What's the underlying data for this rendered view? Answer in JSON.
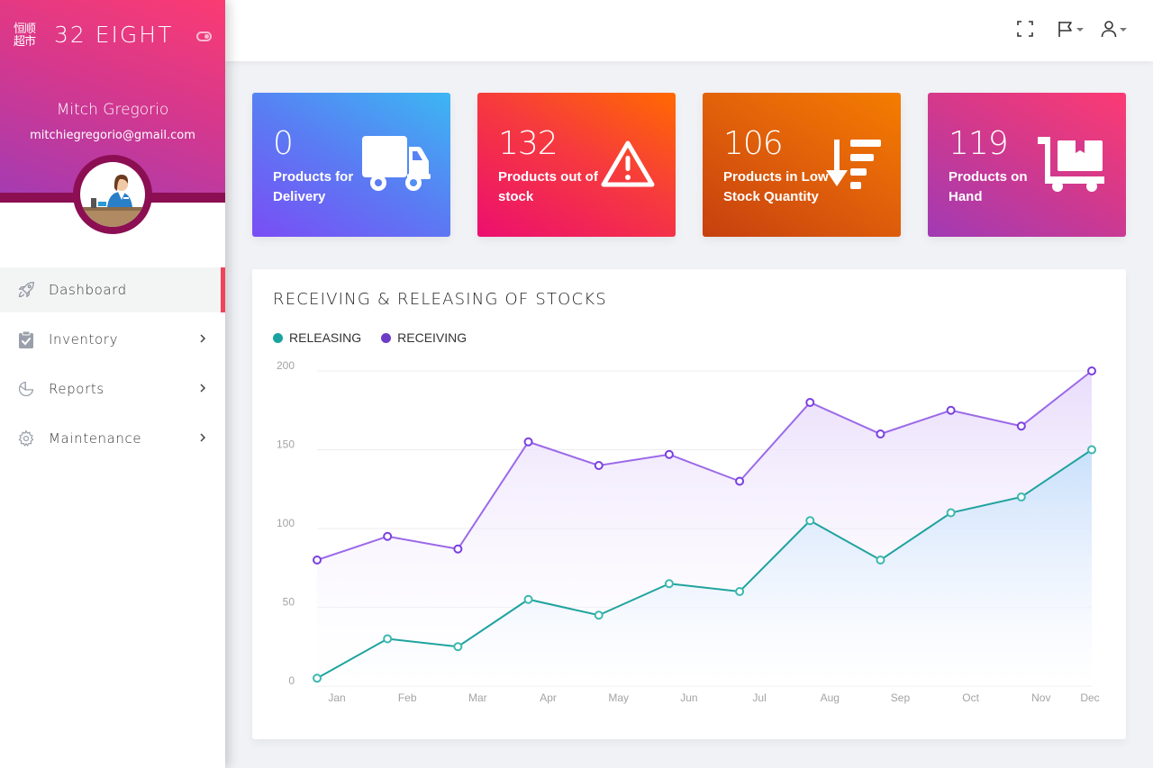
{
  "sidebar": {
    "logo_text": "恒顺超市",
    "brand": "32 EIGHT",
    "user": {
      "name": "Mitch Gregorio",
      "email": "mitchiegregorio@gmail.com"
    },
    "items": [
      {
        "label": "Dashboard",
        "icon": "rocket-icon",
        "active": true,
        "has_submenu": false
      },
      {
        "label": "Inventory",
        "icon": "clipboard-check-icon",
        "active": false,
        "has_submenu": true
      },
      {
        "label": "Reports",
        "icon": "pie-chart-icon",
        "active": false,
        "has_submenu": true
      },
      {
        "label": "Maintenance",
        "icon": "gear-icon",
        "active": false,
        "has_submenu": true
      }
    ],
    "accent_color": "#f0425b"
  },
  "topbar": {
    "icons": [
      "fullscreen-icon",
      "flag-icon",
      "user-icon"
    ]
  },
  "stats": [
    {
      "value": "0",
      "label": "Products for Delivery",
      "icon": "truck-icon",
      "gradient": [
        "#7b4cf5",
        "#3db6f3"
      ]
    },
    {
      "value": "132",
      "label": "Products out of stock",
      "icon": "warning-icon",
      "gradient": [
        "#ec1a6e",
        "#ff6a00"
      ]
    },
    {
      "value": "106",
      "label": "Products in Low Stock Quantity",
      "icon": "sort-amount-down-icon",
      "gradient": [
        "#c9420e",
        "#f27d00"
      ]
    },
    {
      "value": "119",
      "label": "Products on Hand",
      "icon": "dolly-box-icon",
      "gradient": [
        "#a33ab3",
        "#fc3a74"
      ]
    }
  ],
  "chart": {
    "title": "RECEIVING & RELEASING OF STOCKS"
  },
  "chart_data": {
    "type": "area",
    "title": "RECEIVING & RELEASING OF STOCKS",
    "xlabel": "",
    "ylabel": "",
    "categories": [
      "Jan",
      "Feb",
      "Mar",
      "Apr",
      "May",
      "Jun",
      "Jul",
      "Aug",
      "Sep",
      "Oct",
      "Nov",
      "Dec"
    ],
    "series": [
      {
        "name": "RELEASING",
        "color": "#1aa39e",
        "values": [
          5,
          30,
          25,
          55,
          45,
          65,
          60,
          105,
          80,
          110,
          120,
          150
        ]
      },
      {
        "name": "RECEIVING",
        "color": "#8f5ae8",
        "values": [
          80,
          95,
          87,
          155,
          140,
          147,
          130,
          180,
          160,
          175,
          165,
          200
        ]
      }
    ],
    "yticks": [
      0,
      50,
      100,
      150,
      200
    ],
    "ylim": [
      0,
      200
    ],
    "grid": true,
    "legend": "top-left"
  }
}
